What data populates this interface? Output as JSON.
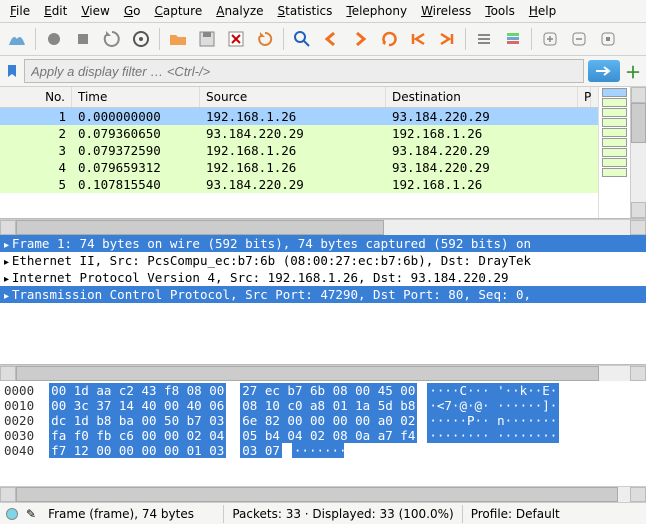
{
  "menu": [
    "File",
    "Edit",
    "View",
    "Go",
    "Capture",
    "Analyze",
    "Statistics",
    "Telephony",
    "Wireless",
    "Tools",
    "Help"
  ],
  "filter": {
    "placeholder": "Apply a display filter … <Ctrl-/>"
  },
  "columns": {
    "no": "No.",
    "time": "Time",
    "src": "Source",
    "dst": "Destination",
    "proto": "P"
  },
  "packets": [
    {
      "no": "1",
      "time": "0.000000000",
      "src": "192.168.1.26",
      "dst": "93.184.220.29",
      "sel": true
    },
    {
      "no": "2",
      "time": "0.079360650",
      "src": "93.184.220.29",
      "dst": "192.168.1.26",
      "grn": true
    },
    {
      "no": "3",
      "time": "0.079372590",
      "src": "192.168.1.26",
      "dst": "93.184.220.29",
      "grn": true
    },
    {
      "no": "4",
      "time": "0.079659312",
      "src": "192.168.1.26",
      "dst": "93.184.220.29",
      "grn": true
    },
    {
      "no": "5",
      "time": "0.107815540",
      "src": "93.184.220.29",
      "dst": "192.168.1.26",
      "grn": true
    }
  ],
  "details": [
    {
      "t": "Frame 1: 74 bytes on wire (592 bits), 74 bytes captured (592 bits) on",
      "sel": true,
      "tri": true
    },
    {
      "t": "Ethernet II, Src: PcsCompu_ec:b7:6b (08:00:27:ec:b7:6b), Dst: DrayTek",
      "tri": true
    },
    {
      "t": "Internet Protocol Version 4, Src: 192.168.1.26, Dst: 93.184.220.29",
      "tri": true
    },
    {
      "t": "Transmission Control Protocol, Src Port: 47290, Dst Port: 80, Seq: 0,",
      "sel": true,
      "tri": true
    }
  ],
  "hex": [
    {
      "off": "0000",
      "h1": "00 1d aa c2 43 f8 08 00",
      "h2": "27 ec b7 6b 08 00 45 00",
      "a": "····C··· '··k··E·"
    },
    {
      "off": "0010",
      "h1": "00 3c 37 14 40 00 40 06",
      "h2": "08 10 c0 a8 01 1a 5d b8",
      "a": "·<7·@·@· ······]·"
    },
    {
      "off": "0020",
      "h1": "dc 1d b8 ba 00 50 b7 03",
      "h2": "6e 82 00 00 00 00 a0 02",
      "a": "·····P·· n·······"
    },
    {
      "off": "0030",
      "h1": "fa f0 fb c6 00 00 02 04",
      "h2": "05 b4 04 02 08 0a a7 f4",
      "a": "········ ········"
    },
    {
      "off": "0040",
      "h1": "f7 12 00 00 00 00 01 03",
      "h2": "03 07",
      "a": "········ ··",
      "half": true
    }
  ],
  "status": {
    "frame": "Frame (frame), 74 bytes",
    "packets": "Packets: 33 · Displayed: 33 (100.0%)",
    "profile": "Profile: Default"
  }
}
